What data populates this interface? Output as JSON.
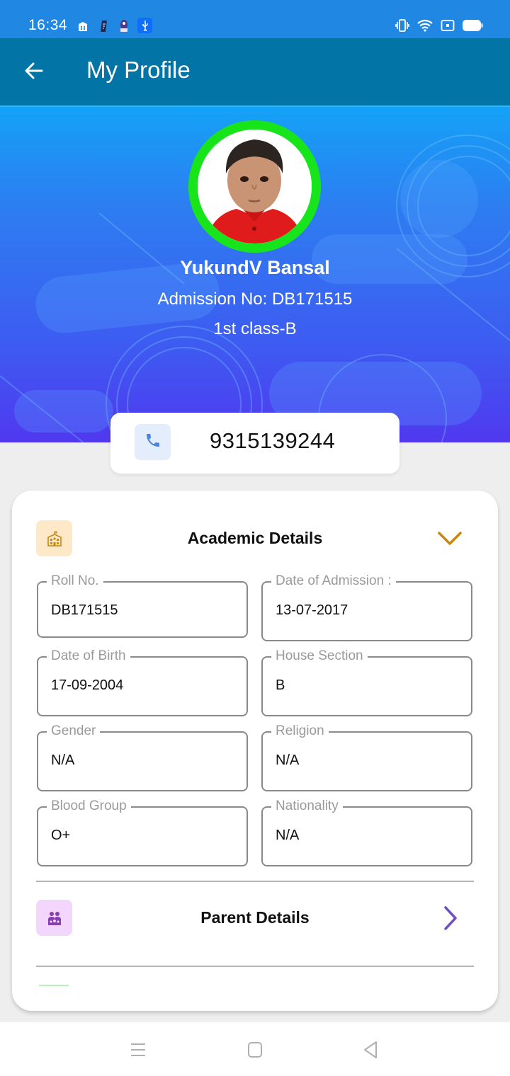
{
  "status_bar": {
    "time": "16:34",
    "left_icons": [
      "hospital-icon",
      "sim-card-icon",
      "notification-app-icon",
      "usb-icon"
    ],
    "right_icons": [
      "vibrate-icon",
      "wifi-icon",
      "sim-icon",
      "battery-icon"
    ]
  },
  "app_bar": {
    "title": "My Profile",
    "back_icon": "arrow-left-icon"
  },
  "profile": {
    "name": "YukundV Bansal",
    "admission": "Admission No: DB171515",
    "class": "1st class-B",
    "avatar_ring_color": "#18e41c",
    "phone": "9315139244"
  },
  "academic": {
    "title": "Academic Details",
    "icon": "school-building-icon",
    "accent": "#c7860d",
    "expanded": true,
    "fields": [
      {
        "label": "Roll No.",
        "value": "DB171515"
      },
      {
        "label": "Date of Admission :",
        "value": "13-07-2017"
      },
      {
        "label": "Date of Birth",
        "value": "17-09-2004"
      },
      {
        "label": "House Section",
        "value": "B"
      },
      {
        "label": "Gender",
        "value": "N/A"
      },
      {
        "label": "Religion",
        "value": "N/A"
      },
      {
        "label": "Blood Group",
        "value": "O+"
      },
      {
        "label": "Nationality",
        "value": "N/A"
      }
    ]
  },
  "parent": {
    "title": "Parent Details",
    "icon": "family-icon",
    "accent": "#6f4fc1"
  },
  "nav_bar": {
    "buttons": [
      "menu-icon",
      "home-icon",
      "back-icon"
    ]
  }
}
